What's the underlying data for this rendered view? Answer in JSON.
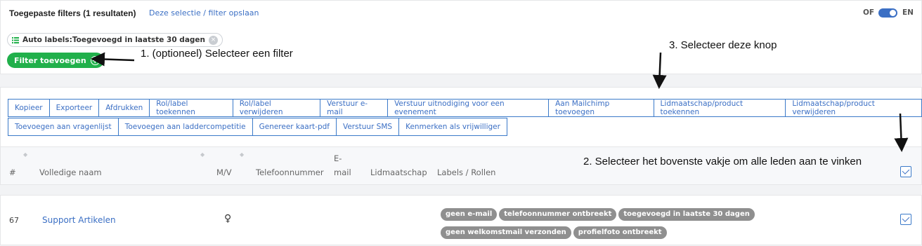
{
  "filters": {
    "title": "Toegepaste filters (1 resultaten)",
    "save_link": "Deze selectie / filter opslaan",
    "toggle_off_label": "OF",
    "toggle_on_label": "EN",
    "chip_label": "Auto labels:Toegevoegd in laatste 30 dagen",
    "chip_close": "×",
    "add_filter_label": "Filter toevoegen",
    "add_filter_icon": "+"
  },
  "actions": {
    "row1": [
      "Kopieer",
      "Exporteer",
      "Afdrukken",
      "Rol/label toekennen",
      "Rol/label verwijderen",
      "Verstuur e-mail",
      "Verstuur uitnodiging voor een evenement",
      "Aan Mailchimp toevoegen",
      "Lidmaatschap/product toekennen",
      "Lidmaatschap/product verwijderen"
    ],
    "row2": [
      "Toevoegen aan vragenlijst",
      "Toevoegen aan laddercompetitie",
      "Genereer kaart-pdf",
      "Verstuur SMS",
      "Kenmerken als vrijwilliger"
    ]
  },
  "table": {
    "headers": {
      "num": "#",
      "name": "Volledige naam",
      "gender": "M/V",
      "phone": "Telefoonnummer",
      "email_1": "E-",
      "email_2": "mail",
      "membership": "Lidmaatschap",
      "labels": "Labels / Rollen"
    },
    "sort_icon": "◆",
    "row": {
      "num": "67",
      "name": "Support Artikelen",
      "gender_icon": "♀",
      "tags": [
        "geen e-mail",
        "telefoonnummer ontbreekt",
        "toegevoegd in laatste 30 dagen",
        "geen welkomstmail verzonden",
        "profielfoto ontbreekt"
      ]
    }
  },
  "annotations": {
    "step1": "1. (optioneel) Selecteer een filter",
    "step2": "2. Selecteer het bovenste vakje om alle leden aan te vinken",
    "step3": "3. Selecteer deze knop"
  }
}
